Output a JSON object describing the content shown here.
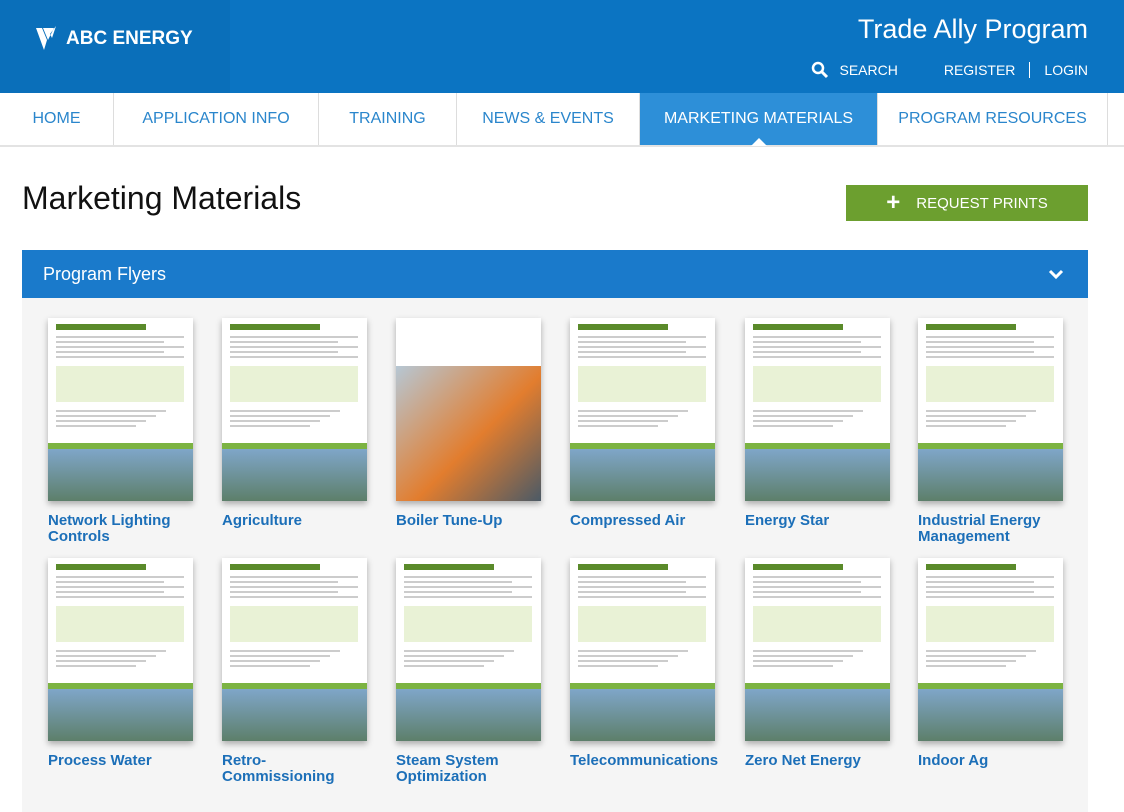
{
  "header": {
    "brand": "ABC ENERGY",
    "program_title": "Trade Ally Program",
    "search": "SEARCH",
    "register": "REGISTER",
    "login": "LOGIN"
  },
  "nav": {
    "tabs": [
      {
        "label": "HOME",
        "w": 114
      },
      {
        "label": "APPLICATION INFO",
        "w": 205
      },
      {
        "label": "TRAINING",
        "w": 138
      },
      {
        "label": "NEWS & EVENTS",
        "w": 183
      },
      {
        "label": "MARKETING MATERIALS",
        "w": 238,
        "active": true
      },
      {
        "label": "PROGRAM RESOURCES",
        "w": 230
      }
    ]
  },
  "page": {
    "title": "Marketing Materials",
    "request_prints": "REQUEST PRINTS"
  },
  "section": {
    "title": "Program Flyers",
    "expanded": true
  },
  "flyers": [
    {
      "label": "Network Lighting Controls"
    },
    {
      "label": "Agriculture"
    },
    {
      "label": "Boiler Tune-Up",
      "photo": true
    },
    {
      "label": "Compressed Air"
    },
    {
      "label": "Energy Star"
    },
    {
      "label": "Industrial Energy Management"
    },
    {
      "label": "Process Water"
    },
    {
      "label": "Retro-Commissioning"
    },
    {
      "label": "Steam System Optimization"
    },
    {
      "label": "Telecommunications"
    },
    {
      "label": "Zero Net Energy"
    },
    {
      "label": "Indoor Ag"
    }
  ],
  "colors": {
    "header": "#0b74c2",
    "active_tab": "#2d8fd8",
    "button": "#6c9f2f",
    "section": "#1a7acb",
    "link": "#1c6fb8"
  }
}
